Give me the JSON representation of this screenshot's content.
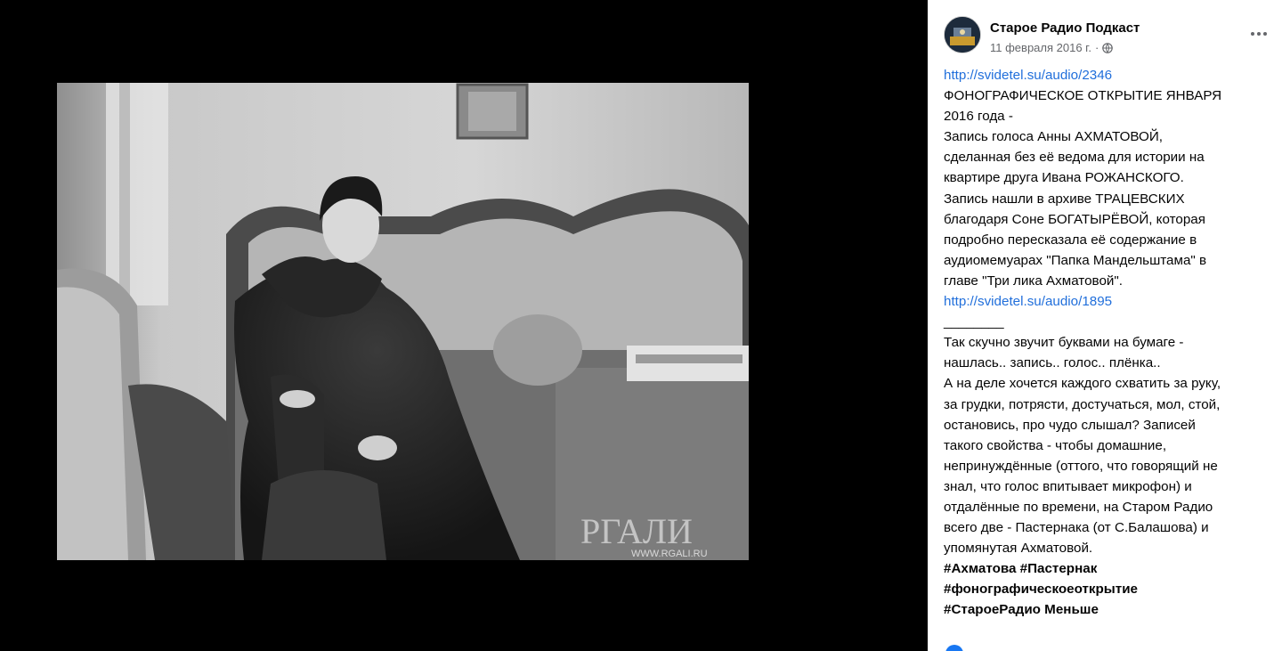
{
  "post": {
    "page_name": "Старое Радио Подкаст",
    "date": "11 февраля 2016 г.",
    "dot": "·",
    "privacy_icon": "globe-icon",
    "more_icon": "more-dots-icon",
    "lines": [
      {
        "text": "http://svidetel.su/audio/2346",
        "kind": "link"
      },
      {
        "text": "ФОНОГРАФИЧЕСКОЕ ОТКРЫТИЕ ЯНВАРЯ",
        "kind": "text"
      },
      {
        "text": "2016 года -",
        "kind": "text"
      },
      {
        "text": "Запись голоса Анны АХМАТОВОЙ,",
        "kind": "text"
      },
      {
        "text": "сделанная без её ведома для истории на",
        "kind": "text"
      },
      {
        "text": "квартире друга Ивана РОЖАНСКОГО.",
        "kind": "text"
      },
      {
        "text": "Запись нашли в архиве ТРАЦЕВСКИХ",
        "kind": "text"
      },
      {
        "text": "благодаря Соне БОГАТЫРЁВОЙ, которая",
        "kind": "text"
      },
      {
        "text": "подробно пересказала её содержание в",
        "kind": "text"
      },
      {
        "text": "аудиомемуарах \"Папка Мандельштама\" в",
        "kind": "text"
      },
      {
        "text": "главе \"Три лика Ахматовой\".",
        "kind": "text"
      },
      {
        "text": "http://svidetel.su/audio/1895",
        "kind": "link"
      },
      {
        "text": "________",
        "kind": "text"
      },
      {
        "text": "Так скучно звучит буквами на бумаге -",
        "kind": "text"
      },
      {
        "text": "нашлась.. запись.. голос.. плёнка..",
        "kind": "text"
      },
      {
        "text": "А на деле хочется каждого схватить за руку,",
        "kind": "text"
      },
      {
        "text": "за грудки, потрясти, достучаться, мол, стой,",
        "kind": "text"
      },
      {
        "text": "остановись, про чудо слышал? Записей",
        "kind": "text"
      },
      {
        "text": "такого свойства - чтобы домашние,",
        "kind": "text"
      },
      {
        "text": "непринуждённые (оттого, что говорящий не",
        "kind": "text"
      },
      {
        "text": "знал, что голос впитывает микрофон) и",
        "kind": "text"
      },
      {
        "text": "отдалённые по времени, на Старом Радио",
        "kind": "text"
      },
      {
        "text": "всего две - Пастернака (от С.Балашова) и",
        "kind": "text"
      },
      {
        "text": "упомянутая Ахматовой.",
        "kind": "text"
      }
    ],
    "hashtags_line1": "#Ахматова #Пастернак",
    "hashtags_line2": "#фонографическоеоткрытие",
    "hashtags_line3_tag": "#СтароеРадио",
    "see_less": "Меньше"
  },
  "photo": {
    "watermark": "РГАЛИ",
    "watermark_url": "WWW.RGALI.RU"
  }
}
